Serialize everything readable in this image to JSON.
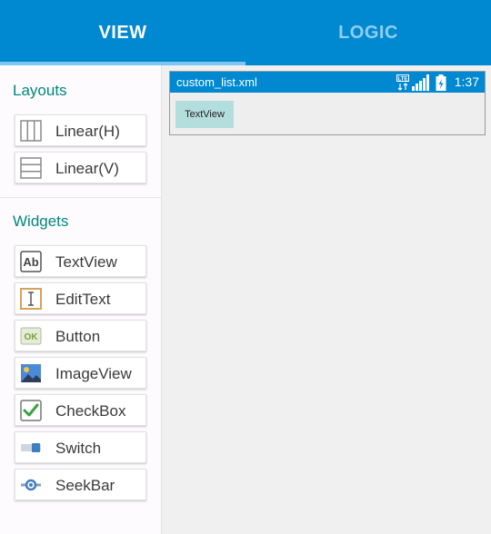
{
  "tabs": [
    {
      "label": "VIEW",
      "active": true
    },
    {
      "label": "LOGIC",
      "active": false
    }
  ],
  "palette": {
    "layouts_title": "Layouts",
    "layouts": [
      {
        "label": "Linear(H)",
        "icon": "linear-horizontal-icon"
      },
      {
        "label": "Linear(V)",
        "icon": "linear-vertical-icon"
      }
    ],
    "widgets_title": "Widgets",
    "widgets": [
      {
        "label": "TextView",
        "icon": "textview-icon"
      },
      {
        "label": "EditText",
        "icon": "edittext-icon"
      },
      {
        "label": "Button",
        "icon": "button-icon"
      },
      {
        "label": "ImageView",
        "icon": "imageview-icon"
      },
      {
        "label": "CheckBox",
        "icon": "checkbox-icon"
      },
      {
        "label": "Switch",
        "icon": "switch-icon"
      },
      {
        "label": "SeekBar",
        "icon": "seekbar-icon"
      }
    ]
  },
  "preview": {
    "filename": "custom_list.xml",
    "time": "1:37",
    "status_icons": [
      "lte-icon",
      "signal-icon",
      "battery-icon"
    ],
    "widgets": [
      {
        "label": "TextView"
      }
    ]
  },
  "colors": {
    "primary": "#0088d1",
    "tab_inactive": "#90cef0",
    "section_title": "#00897b",
    "textview_chip": "#b4dedd"
  }
}
